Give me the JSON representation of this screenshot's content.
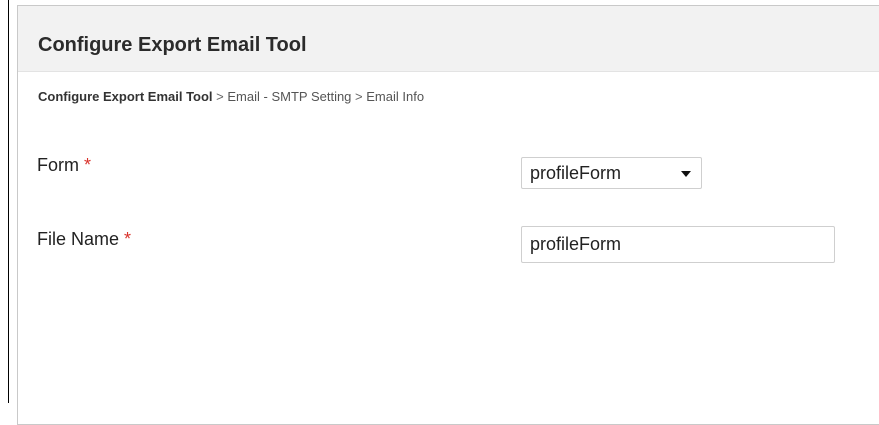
{
  "header": {
    "title": "Configure Export Email Tool"
  },
  "breadcrumb": {
    "items": [
      "Configure Export Email Tool",
      "Email - SMTP Setting",
      "Email Info"
    ],
    "separator": ">"
  },
  "form": {
    "form_field": {
      "label": "Form",
      "required_marker": "*",
      "selected_value": "profileForm"
    },
    "file_name_field": {
      "label": "File Name",
      "required_marker": "*",
      "value": "profileForm"
    }
  },
  "colors": {
    "header_background": "#f2f2f2",
    "required_marker": "#d9322b",
    "border": "#cfcfcf"
  },
  "icons": {
    "select_caret": "chevron-down-icon"
  }
}
